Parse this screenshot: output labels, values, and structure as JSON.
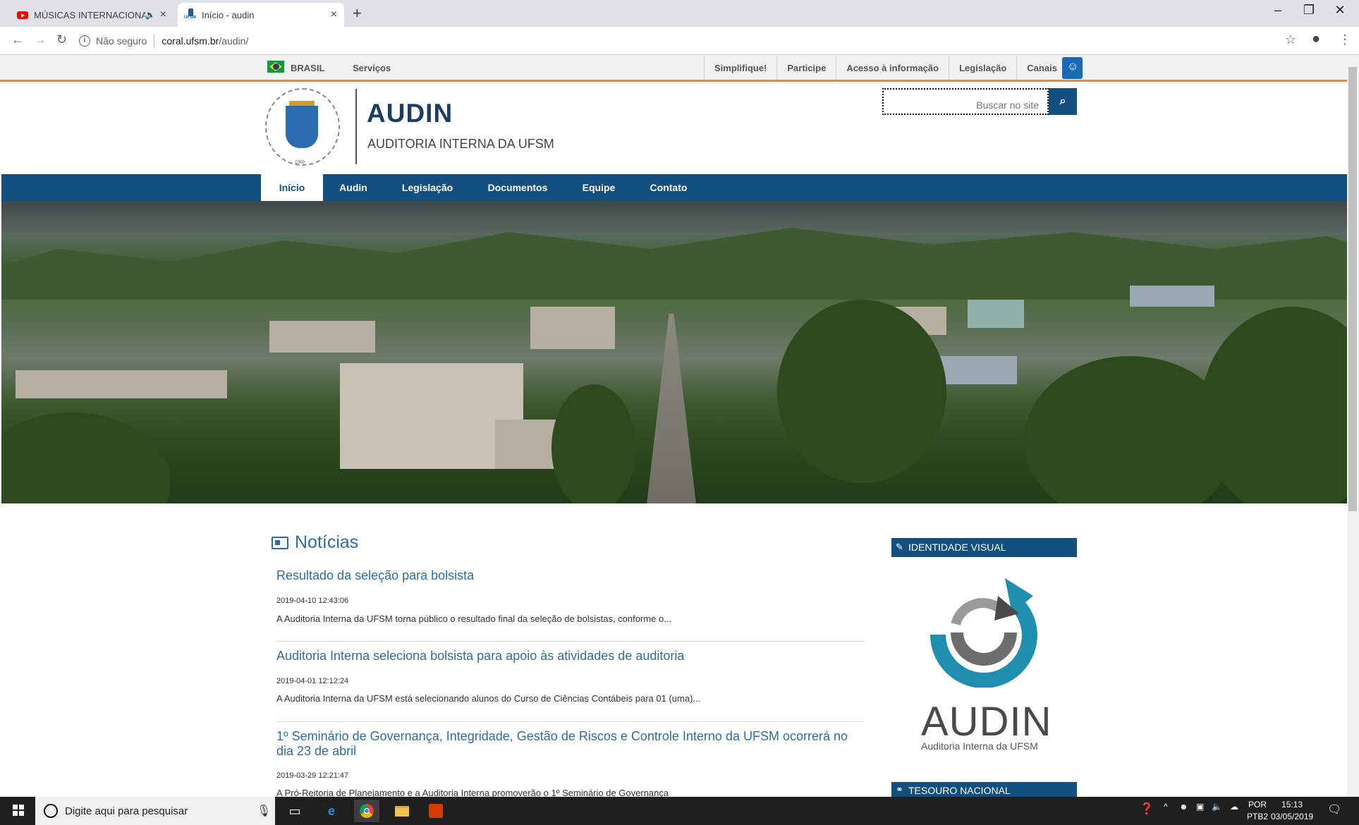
{
  "browser": {
    "tabs": [
      {
        "title": "MÚSICAS INTERNACIONAIS",
        "active": false,
        "icon": "youtube-icon"
      },
      {
        "title": "Início - audin",
        "active": true,
        "icon": "ufsm-favicon"
      }
    ],
    "address": {
      "security": "Não seguro",
      "host": "coral.ufsm.br",
      "path": "/audin/"
    }
  },
  "govbar": {
    "brasil": "BRASIL",
    "servicos": "Serviços",
    "links": [
      "Simplifique!",
      "Participe",
      "Acesso à informação",
      "Legislação",
      "Canais"
    ]
  },
  "header": {
    "seal_text": "Universidade Federal de Santa Maria",
    "seal_year": "1960",
    "title": "AUDIN",
    "subtitle": "AUDITORIA INTERNA DA UFSM",
    "search_placeholder": "Buscar no site"
  },
  "nav": {
    "items": [
      "Início",
      "Audin",
      "Legislação",
      "Documentos",
      "Equipe",
      "Contato"
    ],
    "active_index": 0
  },
  "news": {
    "heading": "Notícias",
    "items": [
      {
        "title": "Resultado da seleção para bolsista",
        "date": "2019-04-10 12:43:06",
        "excerpt": "A Auditoria Interna da UFSM torna público o resultado final da seleção de bolsistas, conforme o..."
      },
      {
        "title": "Auditoria Interna seleciona bolsista para apoio às atividades de auditoria",
        "date": "2019-04-01 12:12:24",
        "excerpt": "A Auditoria Interna da UFSM está selecionando alunos do Curso de Ciências Contábeis para 01 (uma)..."
      },
      {
        "title": "1º Seminário de Governança, Integridade, Gestão de Riscos e Controle Interno da UFSM ocorrerá no dia 23 de abril",
        "date": "2019-03-29 12:21:47",
        "excerpt": "A Pró-Reitoria de Planejamento e a Auditoria Interna promoverão o 1º Seminário de Governança"
      }
    ]
  },
  "sidebar": {
    "identity_heading": "IDENTIDADE VISUAL",
    "logo_word": "AUDIN",
    "logo_caption": "Auditoria Interna da UFSM",
    "tesouro_heading": "TESOURO NACIONAL"
  },
  "taskbar": {
    "search_text": "Digite aqui para pesquisar",
    "lang_top": "POR",
    "lang_bottom": "PTB2",
    "time": "15:13",
    "date": "03/05/2019"
  },
  "colors": {
    "primary": "#13507f",
    "link": "#2e6da4",
    "gov_accent": "#e78f25",
    "logo_teal": "#1f8fb0"
  }
}
